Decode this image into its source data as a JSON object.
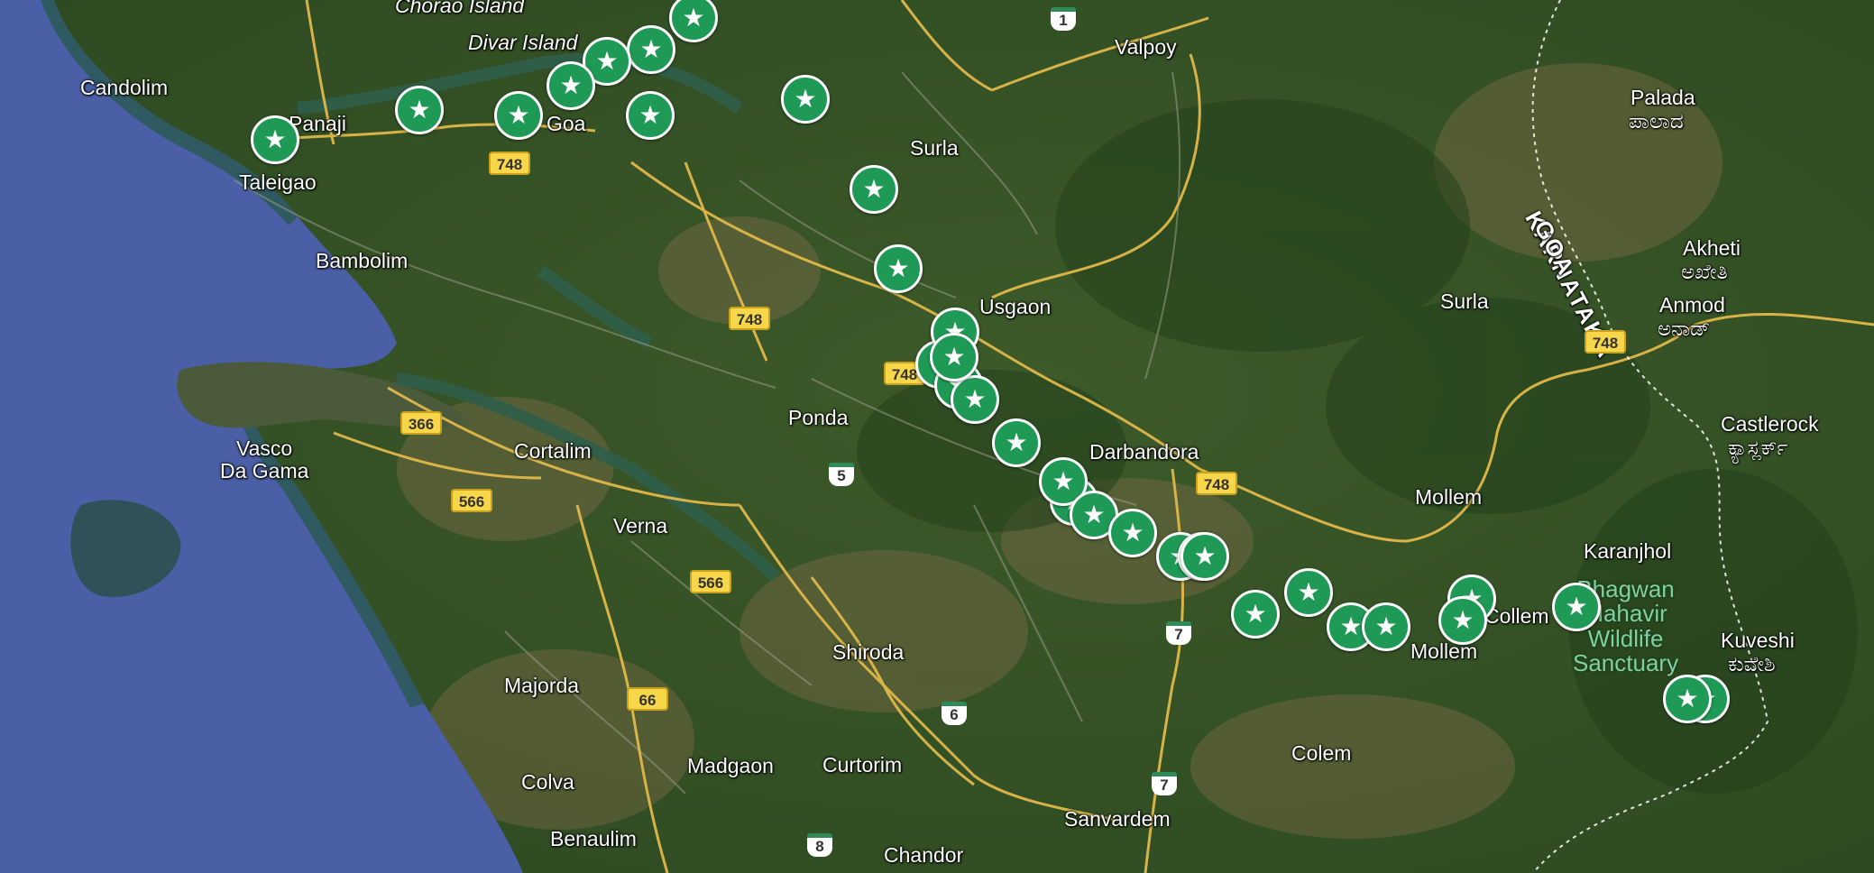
{
  "map": {
    "places": [
      "Chorao Island",
      "Divar Island",
      "Valpoy",
      "Candolim",
      "Panaji",
      "Goa",
      "Taleigao",
      "Surla",
      "Bambolim",
      "Usgaon",
      "Palada",
      "ಪಾಲಾದ",
      "Akheti",
      "ಅಖೇತಿ",
      "Anmod",
      "ಅನಾಡ್",
      "Surla",
      "Castlerock",
      "ಕ್ಯಾಸ್ಲರ್ಕ್",
      "Vasco",
      "Da Gama",
      "Cortalim",
      "Ponda",
      "Darbandora",
      "Mollem",
      "Verna",
      "Karanjhol",
      "Shiroda",
      "Majorda",
      "Kuveshi",
      "ಕುವೇಶಿ",
      "Colva",
      "Madgaon",
      "Curtorim",
      "Colem",
      "Sanvardem",
      "Benaulim",
      "Chandor",
      "Mollem",
      "Collem"
    ],
    "park_label": [
      "Bhagwan",
      "Mahavir",
      "Wildlife",
      "Sanctuary"
    ],
    "border_labels": [
      "KARNATAKA",
      "GOA"
    ],
    "highway_shields": [
      "1",
      "748",
      "748",
      "748",
      "748",
      "366",
      "566",
      "5",
      "566",
      "66",
      "7",
      "6",
      "7",
      "8",
      "748"
    ],
    "markers": [
      {
        "icon": "star-icon",
        "label": "★"
      },
      {
        "icon": "star-icon",
        "label": "★"
      },
      {
        "icon": "star-icon",
        "label": "★"
      },
      {
        "icon": "star-icon",
        "label": "★"
      },
      {
        "icon": "star-icon",
        "label": "★"
      },
      {
        "icon": "star-icon",
        "label": "★"
      },
      {
        "icon": "star-icon",
        "label": "★"
      },
      {
        "icon": "star-icon",
        "label": "★"
      },
      {
        "icon": "star-icon",
        "label": "★"
      },
      {
        "icon": "star-icon",
        "label": "★"
      },
      {
        "icon": "star-icon",
        "label": "★"
      },
      {
        "icon": "star-icon",
        "label": "★"
      },
      {
        "icon": "star-icon",
        "label": "★"
      },
      {
        "icon": "star-icon",
        "label": "★"
      },
      {
        "icon": "star-icon",
        "label": "★"
      },
      {
        "icon": "star-icon",
        "label": "★"
      },
      {
        "icon": "star-icon",
        "label": "★"
      },
      {
        "icon": "star-icon",
        "label": "★"
      },
      {
        "icon": "star-icon",
        "label": "★"
      },
      {
        "icon": "star-icon",
        "label": "★"
      },
      {
        "icon": "star-icon",
        "label": "★"
      },
      {
        "icon": "star-icon",
        "label": "★"
      },
      {
        "icon": "star-icon",
        "label": "★"
      },
      {
        "icon": "star-icon",
        "label": "★"
      },
      {
        "icon": "star-icon",
        "label": "★"
      },
      {
        "icon": "star-icon",
        "label": "★"
      },
      {
        "icon": "star-icon",
        "label": "★"
      },
      {
        "icon": "star-icon",
        "label": "★"
      },
      {
        "icon": "star-icon",
        "label": "★"
      },
      {
        "icon": "star-icon",
        "label": "★"
      },
      {
        "icon": "star-icon",
        "label": "★"
      },
      {
        "icon": "star-icon",
        "label": "★"
      },
      {
        "icon": "star-icon",
        "label": "★"
      }
    ],
    "colors": {
      "sea": "#4a5fa6",
      "land": "#3c5a2a",
      "road": "#e0b84a",
      "marker": "#1f9a56"
    }
  }
}
